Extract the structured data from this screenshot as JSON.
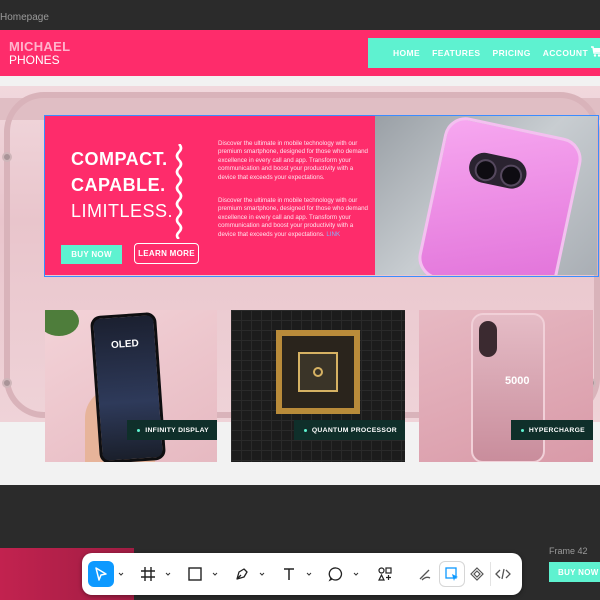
{
  "frame_label": "Homepage",
  "site": {
    "logo_top": "MICHAEL",
    "logo_bottom": "PHONES",
    "nav": [
      "HOME",
      "FEATURES",
      "PRICING",
      "ACCOUNT"
    ]
  },
  "hero": {
    "line1": "COMPACT.",
    "line2": "CAPABLE.",
    "line3": "LIMITLESS.",
    "paragraph1": "Discover the ultimate in mobile technology with our premium smartphone, designed for those who demand excellence in every call and app. Transform your communication and boost your productivity with a device that exceeds your expectations.",
    "paragraph2": "Discover the ultimate in mobile technology with our premium smartphone, designed for those who demand excellence in every call and app. Transform your communication and boost your productivity with a device that exceeds your expectations.",
    "link_word": "LINK",
    "buy_now": "BUY NOW",
    "learn_more": "LEARN MORE"
  },
  "features": [
    {
      "label": "INFINITY DISPLAY",
      "screen_text": "OLED"
    },
    {
      "label": "QUANTUM PROCESSOR"
    },
    {
      "label": "HYPERCHARGE",
      "screen_text": "5000"
    }
  ],
  "below": {
    "frame_name": "Frame 42",
    "mini_button": "BUY NOW"
  },
  "toolbar": {
    "tools": [
      "move-tool",
      "frame-tool",
      "shape-tool",
      "pen-tool",
      "text-tool",
      "comment-tool",
      "actions-tool",
      "draw-mode",
      "design-mode",
      "prototype-mode",
      "dev-mode"
    ]
  },
  "colors": {
    "brand_pink": "#fe2c6b",
    "accent_mint": "#5ef2d0",
    "selection_blue": "#3b8cff",
    "toolbar_active": "#0d99ff"
  }
}
